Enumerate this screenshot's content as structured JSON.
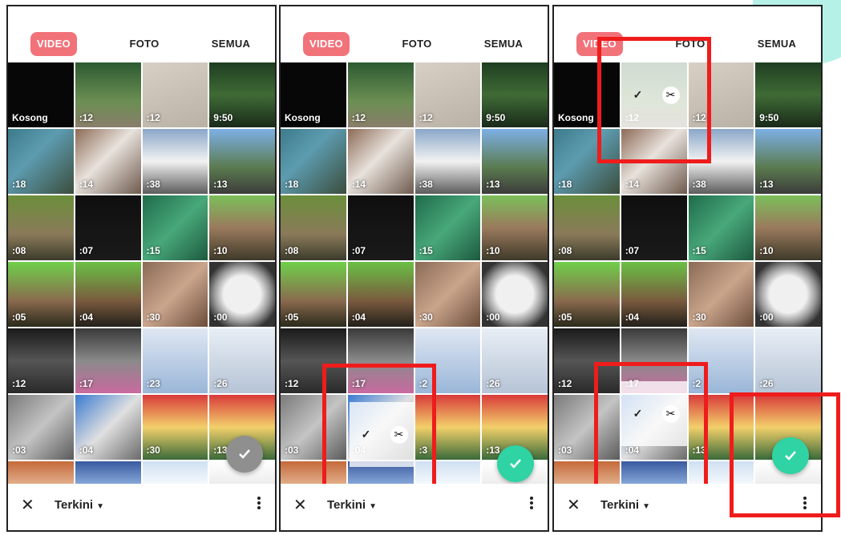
{
  "tabs": {
    "video": "VIDEO",
    "foto": "FOTO",
    "semua": "SEMUA"
  },
  "empty_label": "Kosong",
  "bottom": {
    "sort_label": "Terkini"
  },
  "colors": {
    "active_tab": "#f2727a",
    "fab_gray": "#8f8f8f",
    "fab_teal": "#2fd3a4",
    "highlight": "#ef1c1c"
  },
  "icons": {
    "close": "close-icon",
    "dropdown": "caret-down-icon",
    "more": "more-vertical-icon",
    "check": "check-icon",
    "trim": "scissors-icon"
  },
  "panels": [
    {
      "durations": [
        "Kosong",
        ":12",
        ":12",
        "9:50",
        ":18",
        ":14",
        ":38",
        ":13",
        ":08",
        ":07",
        ":15",
        ":10",
        ":05",
        ":04",
        ":30",
        ":00",
        ":12",
        ":17",
        ":23",
        ":26",
        ":03",
        ":04",
        ":30",
        ":13",
        "",
        "",
        "",
        ""
      ],
      "fab_state": "inactive"
    },
    {
      "durations": [
        "Kosong",
        ":12",
        ":12",
        "9:50",
        ":18",
        ":14",
        ":38",
        ":13",
        ":08",
        ":07",
        ":15",
        ":10",
        ":05",
        ":04",
        ":30",
        ":00",
        ":12",
        ":17",
        ":2",
        ":26",
        ":03",
        ":04",
        ":3",
        ":13",
        "",
        "",
        "",
        ""
      ],
      "fab_state": "active"
    },
    {
      "durations": [
        "Kosong",
        ":12",
        ":12",
        "9:50",
        ":18",
        ":14",
        ":38",
        ":13",
        ":08",
        ":07",
        ":15",
        ":10",
        ":05",
        ":04",
        ":30",
        ":00",
        ":12",
        ":17",
        ":2",
        ":26",
        ":03",
        ":04",
        ":13",
        "",
        "",
        "",
        "",
        ""
      ],
      "fab_state": "active"
    }
  ]
}
